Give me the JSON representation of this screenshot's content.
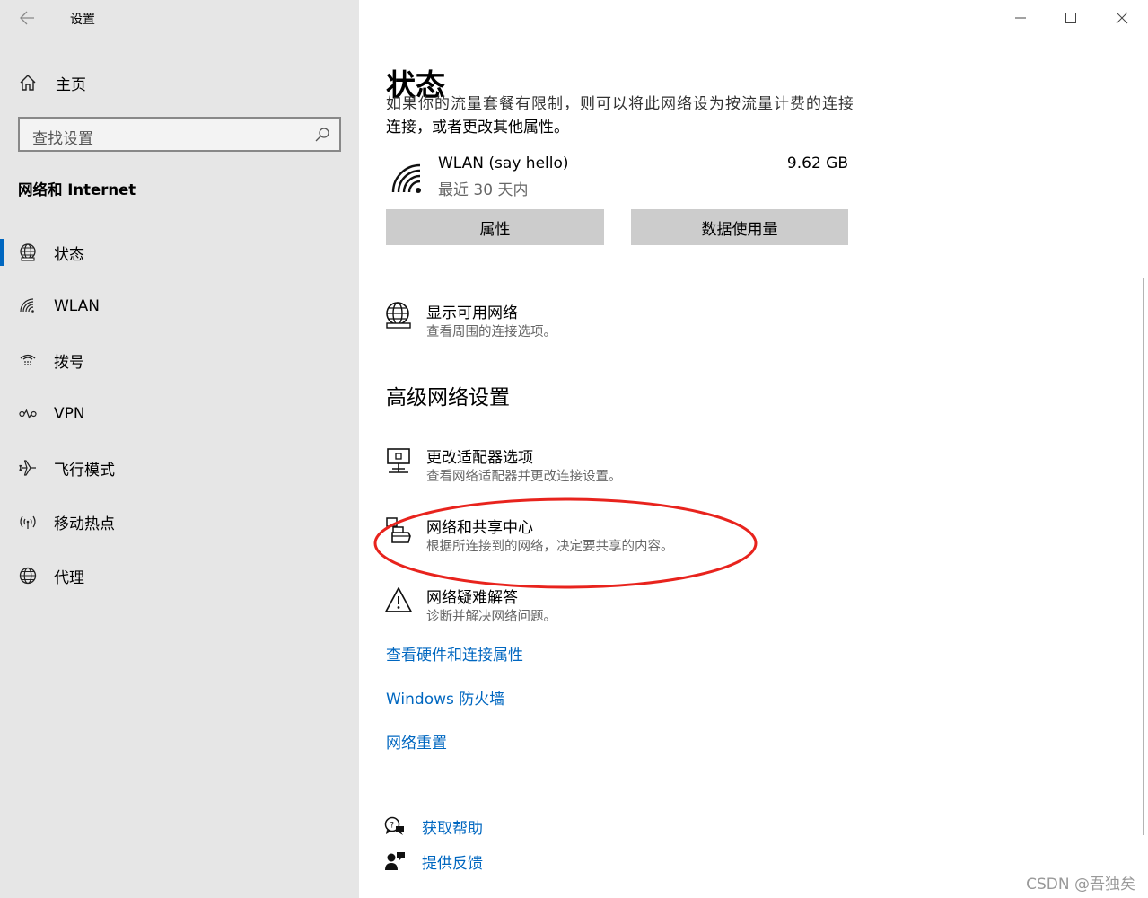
{
  "app": {
    "title": "设置",
    "search_placeholder": "查找设置",
    "group_title": "网络和 Internet"
  },
  "sidebar": {
    "home_label": "主页",
    "items": [
      {
        "label": "状态",
        "icon": "globe-status-icon"
      },
      {
        "label": "WLAN",
        "icon": "wifi-icon"
      },
      {
        "label": "拨号",
        "icon": "dialup-icon"
      },
      {
        "label": "VPN",
        "icon": "vpn-icon"
      },
      {
        "label": "飞行模式",
        "icon": "airplane-icon"
      },
      {
        "label": "移动热点",
        "icon": "hotspot-icon"
      },
      {
        "label": "代理",
        "icon": "proxy-globe-icon"
      }
    ],
    "active_index": 0,
    "accent_color": "#0067c0"
  },
  "main": {
    "title": "状态",
    "intro_cut": "如果你的流量套餐有限制，则可以将此网络设为按流量计费的连接",
    "intro_line": "连接，或者更改其他属性。",
    "wlan": {
      "name": "WLAN (say hello)",
      "period": "最近 30 天内",
      "usage": "9.62 GB"
    },
    "buttons": {
      "properties": "属性",
      "data_usage": "数据使用量"
    },
    "show_networks": {
      "title": "显示可用网络",
      "desc": "查看周围的连接选项。"
    },
    "advanced_title": "高级网络设置",
    "adapter": {
      "title": "更改适配器选项",
      "desc": "查看网络适配器并更改连接设置。"
    },
    "sharing_center": {
      "title": "网络和共享中心",
      "desc": "根据所连接到的网络，决定要共享的内容。"
    },
    "troubleshoot": {
      "title": "网络疑难解答",
      "desc": "诊断并解决网络问题。"
    },
    "links": {
      "hardware": "查看硬件和连接属性",
      "firewall": "Windows 防火墙",
      "reset": "网络重置"
    },
    "help": {
      "get_help": "获取帮助",
      "feedback": "提供反馈"
    },
    "annotation_color": "#e8231d"
  },
  "watermark": "CSDN @吾独矣"
}
